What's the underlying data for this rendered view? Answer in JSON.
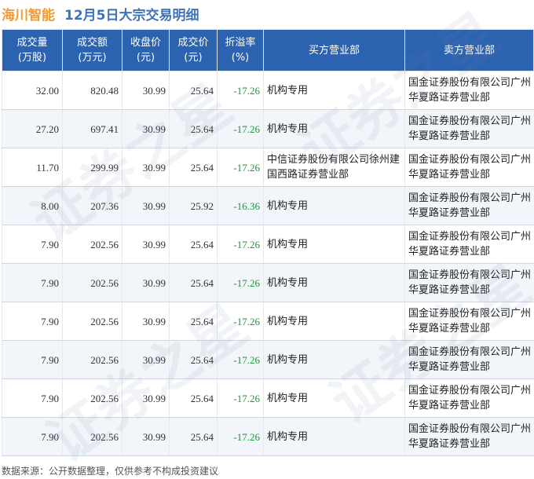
{
  "header": {
    "stock_name": "海川智能",
    "title": "12月5日大宗交易明细"
  },
  "table": {
    "columns": [
      {
        "line1": "成交量",
        "line2": "(万股)"
      },
      {
        "line1": "成交额",
        "line2": "(万元)"
      },
      {
        "line1": "收盘价",
        "line2": "(元)"
      },
      {
        "line1": "成交价",
        "line2": "(元)"
      },
      {
        "line1": "折溢率",
        "line2": "(%)"
      },
      {
        "line1": "买方营业部",
        "line2": ""
      },
      {
        "line1": "卖方营业部",
        "line2": ""
      }
    ],
    "rows": [
      {
        "volume": "32.00",
        "amount": "820.48",
        "close": "30.99",
        "price": "25.64",
        "premium": "-17.26",
        "buyer": "机构专用",
        "seller": "国金证券股份有限公司广州华夏路证券营业部"
      },
      {
        "volume": "27.20",
        "amount": "697.41",
        "close": "30.99",
        "price": "25.64",
        "premium": "-17.26",
        "buyer": "机构专用",
        "seller": "国金证券股份有限公司广州华夏路证券营业部"
      },
      {
        "volume": "11.70",
        "amount": "299.99",
        "close": "30.99",
        "price": "25.64",
        "premium": "-17.26",
        "buyer": "中信证券股份有限公司徐州建国西路证券营业部",
        "seller": "国金证券股份有限公司广州华夏路证券营业部"
      },
      {
        "volume": "8.00",
        "amount": "207.36",
        "close": "30.99",
        "price": "25.92",
        "premium": "-16.36",
        "buyer": "机构专用",
        "seller": "国金证券股份有限公司广州华夏路证券营业部"
      },
      {
        "volume": "7.90",
        "amount": "202.56",
        "close": "30.99",
        "price": "25.64",
        "premium": "-17.26",
        "buyer": "机构专用",
        "seller": "国金证券股份有限公司广州华夏路证券营业部"
      },
      {
        "volume": "7.90",
        "amount": "202.56",
        "close": "30.99",
        "price": "25.64",
        "premium": "-17.26",
        "buyer": "机构专用",
        "seller": "国金证券股份有限公司广州华夏路证券营业部"
      },
      {
        "volume": "7.90",
        "amount": "202.56",
        "close": "30.99",
        "price": "25.64",
        "premium": "-17.26",
        "buyer": "机构专用",
        "seller": "国金证券股份有限公司广州华夏路证券营业部"
      },
      {
        "volume": "7.90",
        "amount": "202.56",
        "close": "30.99",
        "price": "25.64",
        "premium": "-17.26",
        "buyer": "机构专用",
        "seller": "国金证券股份有限公司广州华夏路证券营业部"
      },
      {
        "volume": "7.90",
        "amount": "202.56",
        "close": "30.99",
        "price": "25.64",
        "premium": "-17.26",
        "buyer": "机构专用",
        "seller": "国金证券股份有限公司广州华夏路证券营业部"
      },
      {
        "volume": "7.90",
        "amount": "202.56",
        "close": "30.99",
        "price": "25.64",
        "premium": "-17.26",
        "buyer": "机构专用",
        "seller": "国金证券股份有限公司广州华夏路证券营业部"
      }
    ]
  },
  "footer": {
    "note": "数据来源：公开数据整理，仅供参考不构成投资建议"
  },
  "watermark": {
    "text": "证券之星"
  },
  "colors": {
    "stock_name": "#f39a33",
    "title": "#3f73b8",
    "header_bg": "#2c63b0",
    "negative": "#1a9a3a"
  }
}
